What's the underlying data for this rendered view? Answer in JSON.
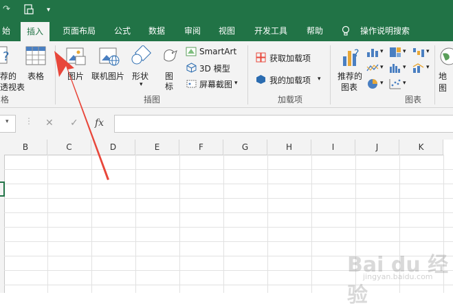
{
  "qat": {
    "redo_icon": "redo-icon",
    "print_icon": "print-preview-icon",
    "more_icon": "qat-dropdown-icon"
  },
  "tabs": [
    {
      "label": "始"
    },
    {
      "label": "插入"
    },
    {
      "label": "页面布局"
    },
    {
      "label": "公式"
    },
    {
      "label": "数据"
    },
    {
      "label": "审阅"
    },
    {
      "label": "视图"
    },
    {
      "label": "开发工具"
    },
    {
      "label": "帮助"
    },
    {
      "label": "操作说明搜索"
    }
  ],
  "ribbon": {
    "tables": {
      "pivot_partial_1": "荐的",
      "pivot_partial_2": "透视表",
      "table": "表格",
      "group": "格"
    },
    "illustrations": {
      "picture": "图片",
      "online_picture": "联机图片",
      "shapes": "形状",
      "icons_1": "图",
      "icons_2": "标",
      "smartart": "SmartArt",
      "model3d": "3D 模型",
      "screenshot": "屏幕截图",
      "group": "插图"
    },
    "addins": {
      "get": "获取加载项",
      "my": "我的加载项",
      "group": "加载项"
    },
    "charts": {
      "recommended_1": "推荐的",
      "recommended_2": "图表",
      "maps": "地图",
      "group": "图表"
    }
  },
  "formula": {
    "cancel": "✕",
    "enter": "✓",
    "fx": "fx",
    "value": ""
  },
  "columns": [
    "B",
    "C",
    "D",
    "E",
    "F",
    "G",
    "H",
    "I",
    "J",
    "K"
  ],
  "watermark": {
    "text": "Bai du 经验",
    "url": "jingyan.baidu.com"
  },
  "colors": {
    "excel_green": "#217346",
    "annotation_red": "#e8473b"
  }
}
